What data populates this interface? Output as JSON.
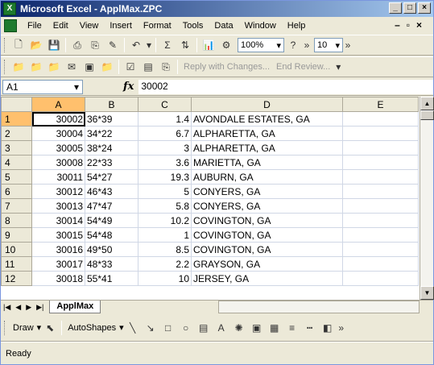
{
  "window": {
    "title": "Microsoft Excel - ApplMax.ZPC",
    "icon_letter": "X"
  },
  "menu": [
    "File",
    "Edit",
    "View",
    "Insert",
    "Format",
    "Tools",
    "Data",
    "Window",
    "Help"
  ],
  "toolbar1": {
    "zoom": "100%",
    "font_size": "10"
  },
  "toolbar2": {
    "reply_label": "Reply with Changes...",
    "end_review_label": "End Review..."
  },
  "formula": {
    "cell_ref": "A1",
    "fx": "fx",
    "value": "30002"
  },
  "sheet": {
    "columns": [
      "A",
      "B",
      "C",
      "D",
      "E"
    ],
    "rows": [
      {
        "n": "1",
        "a": "30002",
        "b": "36*39",
        "c": "1.4",
        "d": "AVONDALE ESTATES, GA"
      },
      {
        "n": "2",
        "a": "30004",
        "b": "34*22",
        "c": "6.7",
        "d": "ALPHARETTA, GA"
      },
      {
        "n": "3",
        "a": "30005",
        "b": "38*24",
        "c": "3",
        "d": "ALPHARETTA, GA"
      },
      {
        "n": "4",
        "a": "30008",
        "b": "22*33",
        "c": "3.6",
        "d": "MARIETTA, GA"
      },
      {
        "n": "5",
        "a": "30011",
        "b": "54*27",
        "c": "19.3",
        "d": "AUBURN, GA"
      },
      {
        "n": "6",
        "a": "30012",
        "b": "46*43",
        "c": "5",
        "d": "CONYERS, GA"
      },
      {
        "n": "7",
        "a": "30013",
        "b": "47*47",
        "c": "5.8",
        "d": "CONYERS, GA"
      },
      {
        "n": "8",
        "a": "30014",
        "b": "54*49",
        "c": "10.2",
        "d": "COVINGTON, GA"
      },
      {
        "n": "9",
        "a": "30015",
        "b": "54*48",
        "c": "1",
        "d": "COVINGTON, GA"
      },
      {
        "n": "10",
        "a": "30016",
        "b": "49*50",
        "c": "8.5",
        "d": "COVINGTON, GA"
      },
      {
        "n": "11",
        "a": "30017",
        "b": "48*33",
        "c": "2.2",
        "d": "GRAYSON, GA"
      },
      {
        "n": "12",
        "a": "30018",
        "b": "55*41",
        "c": "10",
        "d": "JERSEY, GA"
      }
    ],
    "tab": "ApplMax"
  },
  "drawbar": {
    "draw_label": "Draw",
    "autoshapes_label": "AutoShapes"
  },
  "status": {
    "text": "Ready"
  }
}
